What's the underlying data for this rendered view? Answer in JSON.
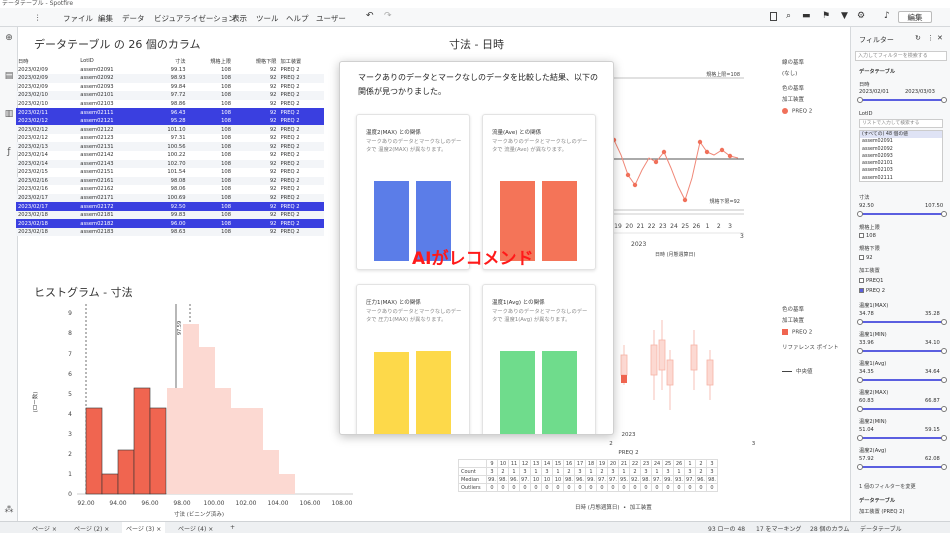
{
  "window": {
    "title": "データテーブル - Spotfire"
  },
  "menu": {
    "items": [
      "ファイル",
      "編集",
      "データ",
      "ビジュアライゼーション",
      "表示",
      "ツール",
      "ヘルプ",
      "ユーザー"
    ],
    "mode": "編集"
  },
  "table_panel": {
    "title": "データテーブル の 26 個のカラム",
    "columns": [
      "日時",
      "LotID",
      "寸法",
      "規格上限",
      "規格下限",
      "加工装置"
    ],
    "rows": [
      [
        "2023/02/09",
        "assem02091",
        "99.13",
        "108",
        "92",
        "PREQ 2"
      ],
      [
        "2023/02/09",
        "assem02092",
        "98.93",
        "108",
        "92",
        "PREQ 2"
      ],
      [
        "2023/02/09",
        "assem02093",
        "99.84",
        "108",
        "92",
        "PREQ 2"
      ],
      [
        "2023/02/10",
        "assem02101",
        "97.72",
        "108",
        "92",
        "PREQ 2"
      ],
      [
        "2023/02/10",
        "assem02103",
        "98.86",
        "108",
        "92",
        "PREQ 2"
      ],
      [
        "2023/02/11",
        "assem02111",
        "96.43",
        "108",
        "92",
        "PREQ 2"
      ],
      [
        "2023/02/12",
        "assem02121",
        "95.28",
        "108",
        "92",
        "PREQ 2"
      ],
      [
        "2023/02/12",
        "assem02122",
        "101.10",
        "108",
        "92",
        "PREQ 2"
      ],
      [
        "2023/02/12",
        "assem02123",
        "97.31",
        "108",
        "92",
        "PREQ 2"
      ],
      [
        "2023/02/13",
        "assem02131",
        "100.56",
        "108",
        "92",
        "PREQ 2"
      ],
      [
        "2023/02/14",
        "assem02142",
        "100.22",
        "108",
        "92",
        "PREQ 2"
      ],
      [
        "2023/02/14",
        "assem02143",
        "102.70",
        "108",
        "92",
        "PREQ 2"
      ],
      [
        "2023/02/15",
        "assem02151",
        "101.54",
        "108",
        "92",
        "PREQ 2"
      ],
      [
        "2023/02/16",
        "assem02161",
        "98.08",
        "108",
        "92",
        "PREQ 2"
      ],
      [
        "2023/02/16",
        "assem02162",
        "98.06",
        "108",
        "92",
        "PREQ 2"
      ],
      [
        "2023/02/17",
        "assem02171",
        "100.69",
        "108",
        "92",
        "PREQ 2"
      ],
      [
        "2023/02/17",
        "assem02172",
        "92.50",
        "108",
        "92",
        "PREQ 2"
      ],
      [
        "2023/02/18",
        "assem02181",
        "99.83",
        "108",
        "92",
        "PREQ 2"
      ],
      [
        "2023/02/18",
        "assem02182",
        "96.00",
        "108",
        "92",
        "PREQ 2"
      ],
      [
        "2023/02/18",
        "assem02183",
        "98.63",
        "108",
        "92",
        "PREQ 2"
      ]
    ],
    "selected_rows": [
      5,
      6,
      16,
      18
    ]
  },
  "line_panel": {
    "title": "寸法 - 日時",
    "upper_label": "規格上限=108",
    "lower_label": "規格下限=92",
    "x_ticks": [
      "19",
      "20",
      "21",
      "22",
      "23",
      "24",
      "25",
      "26",
      "1",
      "2",
      "3"
    ],
    "x_tick_2": "3",
    "year": "2023",
    "x_axis": "日時 (月態週算日)",
    "color": "#f0705a"
  },
  "right_legend": {
    "row_basis_label": "線の基準",
    "row_basis_value": "(なし)",
    "color_basis_label": "色の基準",
    "color_basis_value": "加工装置",
    "item": "PREQ 2"
  },
  "hist_panel": {
    "title": "ヒストグラム - 寸法",
    "ylabel": "(ロー数)",
    "xlabel": "寸法 (ビニング済み)",
    "ref_label": "97.59"
  },
  "box_panel": {
    "legend_color_label": "色の基準",
    "legend_color_value": "加工装置",
    "legend_item": "PREQ 2",
    "ref_points_label": "リファレンス ポイント",
    "median_label": "中央値",
    "x_axis": "日時 (月態週算日)",
    "x_axis2": "加工装置",
    "table": {
      "year": "2023",
      "group": "PREQ 2",
      "month_2": "2",
      "month_3": "3",
      "days": [
        "9",
        "10",
        "11",
        "12",
        "13",
        "14",
        "15",
        "16",
        "17",
        "18",
        "19",
        "20",
        "21",
        "22",
        "23",
        "24",
        "25",
        "26",
        "1",
        "2",
        "3"
      ],
      "rows": [
        {
          "label": "Count",
          "values": [
            "3",
            "2",
            "1",
            "3",
            "1",
            "3",
            "1",
            "2",
            "3",
            "1",
            "2",
            "3",
            "1",
            "2",
            "3",
            "1",
            "3",
            "1",
            "3",
            "2",
            "3"
          ]
        },
        {
          "label": "Median",
          "values": [
            "99.",
            "98.",
            "96.",
            "97.",
            "10",
            "10",
            "10",
            "98.",
            "96.",
            "99.",
            "97.",
            "97.",
            "95.",
            "92.",
            "98.",
            "97.",
            "99.",
            "93.",
            "97.",
            "96.",
            "98."
          ]
        },
        {
          "label": "Outliers",
          "values": [
            "0",
            "0",
            "0",
            "0",
            "0",
            "0",
            "0",
            "0",
            "0",
            "0",
            "0",
            "0",
            "0",
            "0",
            "0",
            "0",
            "0",
            "0",
            "0",
            "0",
            "0"
          ]
        }
      ]
    }
  },
  "ai_recommend": {
    "heading": "マークありのデータとマークなしのデータを比較した結果、以下の関係が見つかりました。",
    "overlay": "AIがレコメンド",
    "cards": [
      {
        "title": "温度2(MAX) との関係",
        "desc": "マークありのデータとマークなしのデータで 温度2(MAX) が異なります。",
        "color": "#5b7de8"
      },
      {
        "title": "流量(Ave) との関係",
        "desc": "マークありのデータとマークなしのデータで 流量(Ave) が異なります。",
        "color": "#f47458"
      },
      {
        "title": "圧力1(MAX) との関係",
        "desc": "マークありのデータとマークなしのデータで 圧力1(MAX) が異なります。",
        "color": "#fdd94a"
      },
      {
        "title": "温度1(Avg) との関係",
        "desc": "マークありのデータとマークなしのデータで 温度1(Avg) が異なります。",
        "color": "#6fdc8c"
      }
    ]
  },
  "filter_panel": {
    "title": "フィルター",
    "search_placeholder": "入力してフィルターを検索する",
    "section": "データテーブル",
    "date_label": "日時",
    "date_from": "2023/02/01",
    "date_to": "2023/03/03",
    "lot_label": "LotID",
    "lot_search": "リストで入力して検索する",
    "lot_items": [
      "(すべての) 48 個の値",
      "assem02091",
      "assem02092",
      "assem02093",
      "assem02101",
      "assem02103",
      "assem02111"
    ],
    "dim_label": "寸法",
    "dim_min": "92.50",
    "dim_max": "107.50",
    "upper_label": "規格上限",
    "upper_val": "108",
    "lower_label": "規格下限",
    "lower_val": "92",
    "equip_label": "加工装置",
    "equip_items": [
      "PREQ1",
      "PREQ 2"
    ],
    "ranges": [
      {
        "label": "温度1(MAX)",
        "min": "34.78",
        "max": "35.28"
      },
      {
        "label": "温度1(MIN)",
        "min": "33.96",
        "max": "34.10"
      },
      {
        "label": "温度1(Avg)",
        "min": "34.35",
        "max": "34.64"
      },
      {
        "label": "温度2(MAX)",
        "min": "60.83",
        "max": "66.87"
      },
      {
        "label": "温度2(MIN)",
        "min": "51.04",
        "max": "59.15"
      },
      {
        "label": "温度2(Avg)",
        "min": "57.92",
        "max": "62.08"
      }
    ],
    "footer_note": "1 個のフィルターを変更",
    "footer_section": "データテーブル",
    "footer_item": "加工装置 (PREQ 2)"
  },
  "tabs": [
    "ページ",
    "ページ (2)",
    "ページ (3)",
    "ページ (4)"
  ],
  "status": {
    "rows": "93 ローの 48",
    "marked": "17 をマーキング",
    "cols": "28 個のカラム",
    "table": "データテーブル"
  }
}
